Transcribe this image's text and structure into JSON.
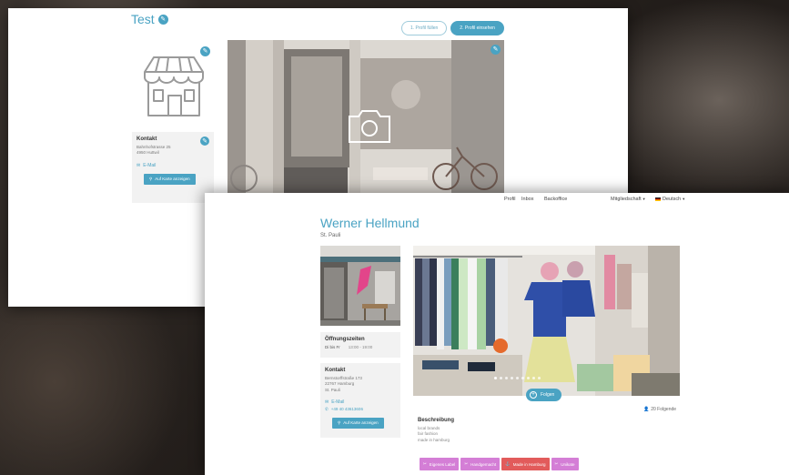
{
  "back": {
    "title": "Test",
    "steps": [
      "1. Profil füllen",
      "2. Profil einsehen"
    ],
    "contact": {
      "heading": "Kontakt",
      "street": "Bahnhofstrasse 25",
      "city": "4950 Huttwil",
      "email": "E-Mail",
      "map_button": "Auf Karte anzeigen"
    }
  },
  "front": {
    "nav": {
      "profile": "Profil",
      "inbox": "Inbox",
      "backoffice": "Backoffice",
      "membership": "Mitgliedschaft",
      "language": "Deutsch"
    },
    "shop_name": "Werner Hellmund",
    "location": "St. Pauli",
    "hours": {
      "heading": "Öffnungszeiten",
      "day": "Di bis Fr",
      "time": "13:00 - 19:00"
    },
    "contact": {
      "heading": "Kontakt",
      "street": "Bernstorffstraße 173",
      "city": "22767 Hamburg",
      "district": "St. Pauli",
      "email": "E-Mail",
      "phone": "+49 40 43613606",
      "map_button": "Auf Karte anzeigen"
    },
    "follow_button": "Folgen",
    "followers": "20 Folgende",
    "description": {
      "heading": "Beschreibung",
      "lines": [
        "local brands",
        "fair fashion",
        "made in hamburg"
      ]
    },
    "tags": [
      {
        "label": "Eigenes Label",
        "icon": "scissors-icon",
        "color": "#d47ed6"
      },
      {
        "label": "Handgemacht",
        "icon": "scissors-icon",
        "color": "#d47ed6"
      },
      {
        "label": "Made in Hamburg",
        "icon": "anchor-icon",
        "color": "#e25b5b"
      },
      {
        "label": "Unikate",
        "icon": "scissors-icon",
        "color": "#d47ed6"
      }
    ]
  },
  "colors": {
    "accent": "#4aa3c3",
    "tag": "#d47ed6",
    "tag_hamburg": "#e25b5b"
  }
}
